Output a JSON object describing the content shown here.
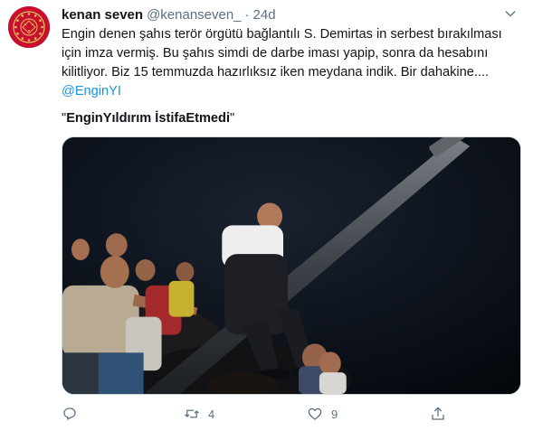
{
  "tweet": {
    "author": {
      "display_name": "kenan seven",
      "handle": "@kenanseven_",
      "separator": "·",
      "time": "24d"
    },
    "text_lines": [
      "Engin denen şahıs terör örgütü bağlantılı S. Demirtas in serbest bırakılması",
      "için imza vermiş. Bu şahıs simdi de darbe iması yapip, sonra da hesabını",
      "kilitliyor. Biz 15 temmuzda hazırlıksız iken meydana indik. Bir dahakine...."
    ],
    "mention": "@EnginYI",
    "quote": {
      "open": "\"",
      "hashtag": "EnginYıldırım İstifaEtmedi",
      "close": "\""
    },
    "actions": {
      "reply_count": "",
      "retweet_count": "4",
      "like_count": "9"
    },
    "icons": {
      "avatar": "presidential-seal-icon",
      "more": "chevron-down-icon",
      "reply": "reply-icon",
      "retweet": "retweet-icon",
      "like": "heart-icon",
      "share": "share-icon"
    },
    "colors": {
      "text": "#0f1419",
      "secondary": "#5b7083",
      "link": "#1b95e0",
      "avatar_bg": "#c8102e"
    }
  }
}
